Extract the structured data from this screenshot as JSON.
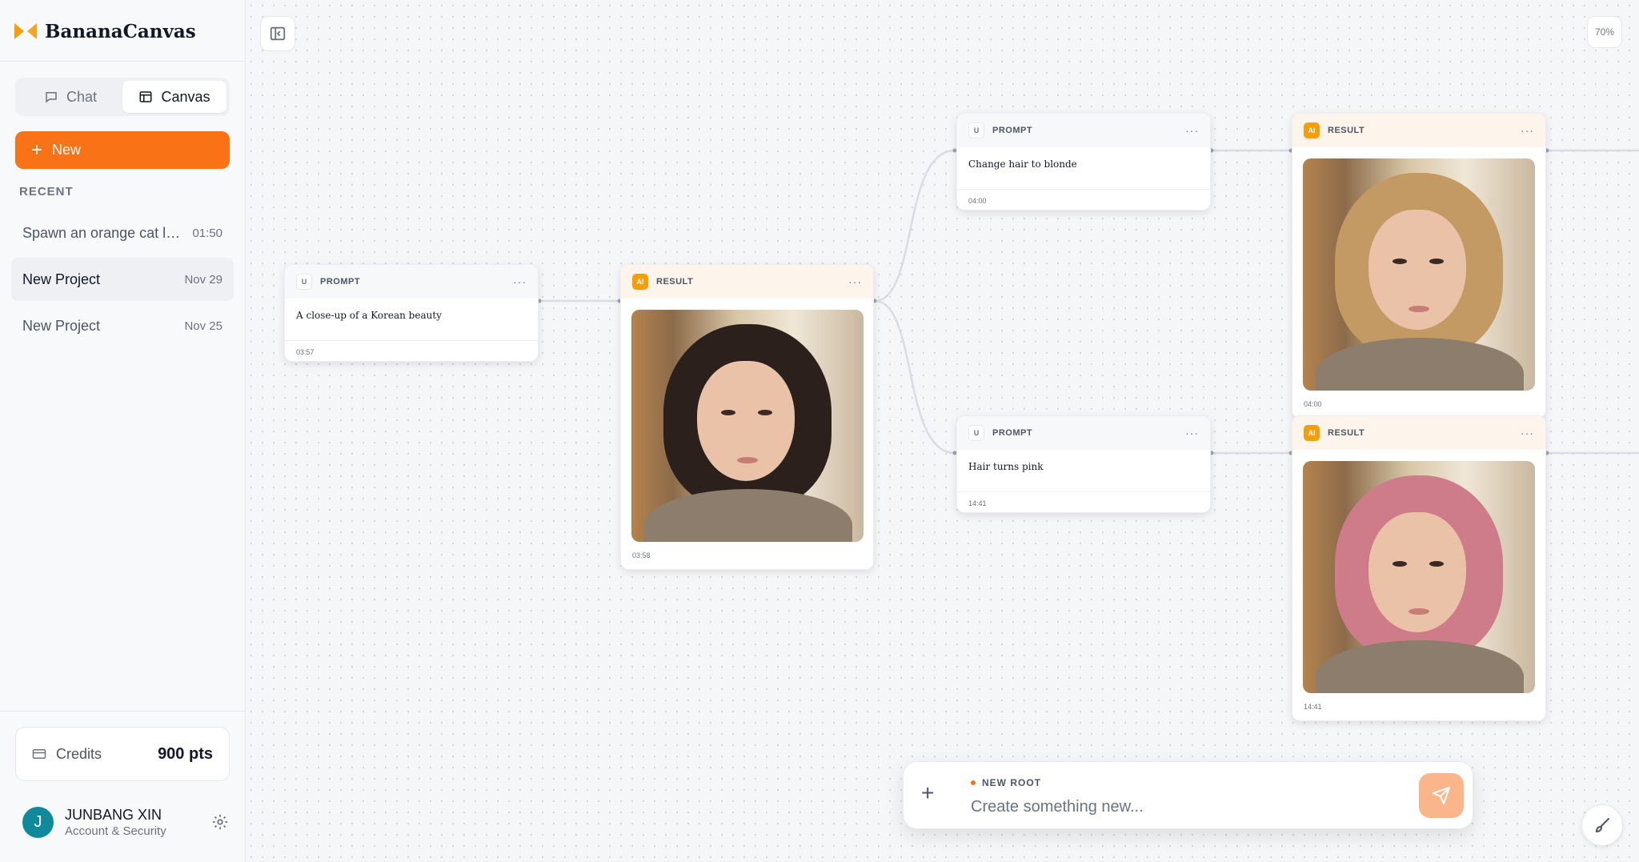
{
  "brand": {
    "name": "BananaCanvas"
  },
  "modes": [
    {
      "label": "Chat",
      "icon": "chat-bubble-icon",
      "active": false
    },
    {
      "label": "Canvas",
      "icon": "layout-icon",
      "active": true
    }
  ],
  "new_button": {
    "label": "New"
  },
  "recent": {
    "label": "RECENT",
    "items": [
      {
        "title": "Spawn an orange cat lying on the sofa",
        "date": "01:50",
        "active": false
      },
      {
        "title": "New Project",
        "date": "Nov 29",
        "active": true
      },
      {
        "title": "New Project",
        "date": "Nov 25",
        "active": false
      }
    ]
  },
  "credits": {
    "label": "Credits",
    "value": "900 pts"
  },
  "user": {
    "initial": "J",
    "name": "JUNBANG XIN",
    "subtitle": "Account & Security"
  },
  "canvas": {
    "zoom": "70%"
  },
  "nodes": {
    "prompt1": {
      "type": "PROMPT",
      "badge": "U",
      "text": "A close-up of a Korean beauty",
      "time": "03:57"
    },
    "result1": {
      "type": "RESULT",
      "badge": "AI",
      "time": "03:58",
      "hair_color": "#2b201c"
    },
    "prompt2": {
      "type": "PROMPT",
      "badge": "U",
      "text": "Change hair to blonde",
      "time": "04:00"
    },
    "result2": {
      "type": "RESULT",
      "badge": "AI",
      "time": "04:00",
      "hair_color": "#c49a64"
    },
    "prompt3": {
      "type": "PROMPT",
      "badge": "U",
      "text": "Hair turns pink",
      "time": "14:41"
    },
    "result3": {
      "type": "RESULT",
      "badge": "AI",
      "time": "14:41",
      "hair_color": "#cf7c8a"
    },
    "menu_glyph": "···"
  },
  "prompt_bar": {
    "tag": "NEW ROOT",
    "placeholder": "Create something new..."
  },
  "colors": {
    "accent": "#f97316",
    "ai_badge": "#f59e0b",
    "avatar": "#0e8a9a"
  }
}
